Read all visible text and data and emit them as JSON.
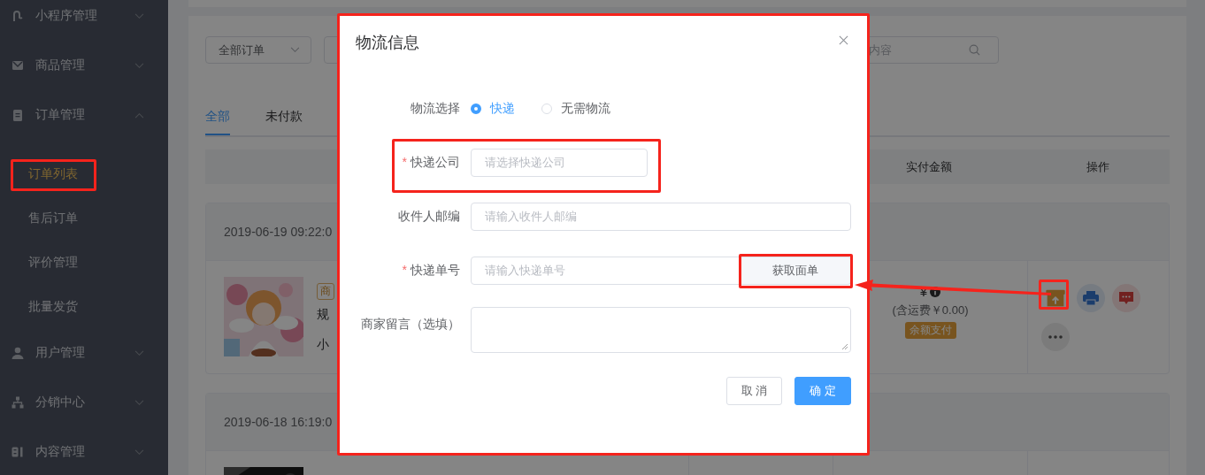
{
  "sidebar": {
    "items": [
      {
        "label": "小程序管理",
        "expanded": false
      },
      {
        "label": "商品管理",
        "expanded": false
      },
      {
        "label": "订单管理",
        "expanded": true,
        "children": [
          {
            "label": "订单列表",
            "selected": true
          },
          {
            "label": "售后订单",
            "selected": false
          },
          {
            "label": "评价管理",
            "selected": false
          },
          {
            "label": "批量发货",
            "selected": false
          }
        ]
      },
      {
        "label": "用户管理",
        "expanded": false
      },
      {
        "label": "分销中心",
        "expanded": false
      },
      {
        "label": "内容管理",
        "expanded": false
      }
    ]
  },
  "filters": {
    "order_type": "全部订单",
    "search_placeholder": "内容"
  },
  "tabs": [
    {
      "label": "全部",
      "selected": true
    },
    {
      "label": "未付款",
      "selected": false
    }
  ],
  "table": {
    "columns": [
      {
        "label": "实付金额"
      },
      {
        "label": "操作"
      }
    ]
  },
  "orders": [
    {
      "time": "2019-06-19 09:22:0",
      "tag": "商",
      "spec": "规",
      "subtotal": "小",
      "amount": "¥",
      "shipping": "(含运费￥0.00)",
      "pay_method": "余额支付"
    },
    {
      "time": "2019-06-18 16:19:0"
    }
  ],
  "dialog": {
    "title": "物流信息",
    "delivery": {
      "label": "物流选择",
      "options": [
        {
          "label": "快递",
          "selected": true
        },
        {
          "label": "无需物流",
          "selected": false
        }
      ]
    },
    "fields": [
      {
        "kind": "select",
        "marker": "*",
        "label": "快递公司",
        "placeholder": "请选择快递公司"
      },
      {
        "kind": "input",
        "label": "收件人邮编",
        "placeholder": "请输入收件人邮编"
      },
      {
        "kind": "input_button",
        "marker": "*",
        "label": "快递单号",
        "placeholder": "请输入快递单号",
        "button": "获取面单"
      },
      {
        "kind": "textarea",
        "label": "商家留言（选填）"
      }
    ],
    "buttons": [
      {
        "kind": "secondary",
        "label": "取 消"
      },
      {
        "kind": "primary",
        "label": "确 定"
      }
    ]
  }
}
